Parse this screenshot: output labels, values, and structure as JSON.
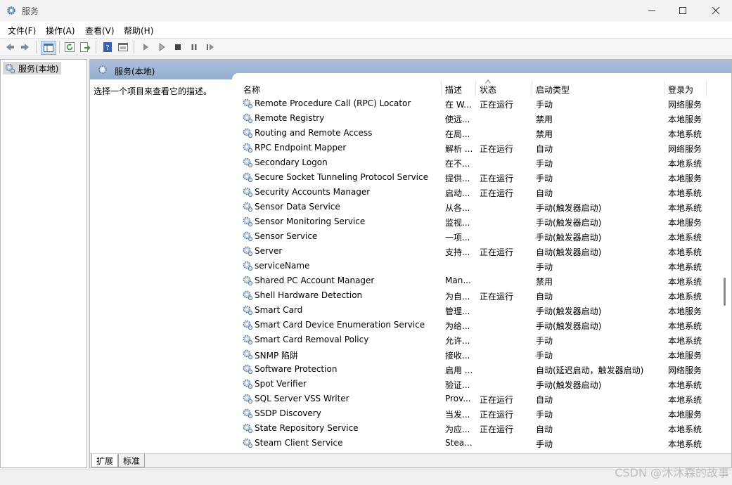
{
  "window": {
    "title": "服务"
  },
  "menu": [
    "文件(F)",
    "操作(A)",
    "查看(V)",
    "帮助(H)"
  ],
  "tree": {
    "root": "服务(本地)"
  },
  "content": {
    "header": "服务(本地)",
    "description": "选择一个项目来查看它的描述。"
  },
  "columns": {
    "name": "名称",
    "desc": "描述",
    "status": "状态",
    "startup": "启动类型",
    "logon": "登录为"
  },
  "services": [
    {
      "name": "Remote Procedure Call (RPC) Locator",
      "desc": "在 W...",
      "status": "正在运行",
      "startup": "手动",
      "logon": "网络服务"
    },
    {
      "name": "Remote Registry",
      "desc": "使远...",
      "status": "",
      "startup": "禁用",
      "logon": "本地服务"
    },
    {
      "name": "Routing and Remote Access",
      "desc": "在局...",
      "status": "",
      "startup": "禁用",
      "logon": "本地系统"
    },
    {
      "name": "RPC Endpoint Mapper",
      "desc": "解析 ...",
      "status": "正在运行",
      "startup": "自动",
      "logon": "网络服务"
    },
    {
      "name": "Secondary Logon",
      "desc": "在不...",
      "status": "",
      "startup": "手动",
      "logon": "本地系统"
    },
    {
      "name": "Secure Socket Tunneling Protocol Service",
      "desc": "提供...",
      "status": "正在运行",
      "startup": "手动",
      "logon": "本地服务"
    },
    {
      "name": "Security Accounts Manager",
      "desc": "启动...",
      "status": "正在运行",
      "startup": "自动",
      "logon": "本地系统"
    },
    {
      "name": "Sensor Data Service",
      "desc": "从各...",
      "status": "",
      "startup": "手动(触发器启动)",
      "logon": "本地系统"
    },
    {
      "name": "Sensor Monitoring Service",
      "desc": "监视...",
      "status": "",
      "startup": "手动(触发器启动)",
      "logon": "本地服务"
    },
    {
      "name": "Sensor Service",
      "desc": "一项...",
      "status": "",
      "startup": "手动(触发器启动)",
      "logon": "本地系统"
    },
    {
      "name": "Server",
      "desc": "支持...",
      "status": "正在运行",
      "startup": "自动(触发器启动)",
      "logon": "本地系统"
    },
    {
      "name": "serviceName",
      "desc": "",
      "status": "",
      "startup": "手动",
      "logon": "本地系统"
    },
    {
      "name": "Shared PC Account Manager",
      "desc": "Man...",
      "status": "",
      "startup": "禁用",
      "logon": "本地系统"
    },
    {
      "name": "Shell Hardware Detection",
      "desc": "为自...",
      "status": "正在运行",
      "startup": "自动",
      "logon": "本地系统"
    },
    {
      "name": "Smart Card",
      "desc": "管理...",
      "status": "",
      "startup": "手动(触发器启动)",
      "logon": "本地服务"
    },
    {
      "name": "Smart Card Device Enumeration Service",
      "desc": "为给...",
      "status": "",
      "startup": "手动(触发器启动)",
      "logon": "本地系统"
    },
    {
      "name": "Smart Card Removal Policy",
      "desc": "允许...",
      "status": "",
      "startup": "手动",
      "logon": "本地系统"
    },
    {
      "name": "SNMP 陷阱",
      "desc": "接收...",
      "status": "",
      "startup": "手动",
      "logon": "本地服务"
    },
    {
      "name": "Software Protection",
      "desc": "启用 ...",
      "status": "",
      "startup": "自动(延迟启动，触发器启动)",
      "logon": "网络服务"
    },
    {
      "name": "Spot Verifier",
      "desc": "验证...",
      "status": "",
      "startup": "手动(触发器启动)",
      "logon": "本地系统"
    },
    {
      "name": "SQL Server VSS Writer",
      "desc": "Prov...",
      "status": "正在运行",
      "startup": "自动",
      "logon": "本地系统"
    },
    {
      "name": "SSDP Discovery",
      "desc": "当发...",
      "status": "正在运行",
      "startup": "手动",
      "logon": "本地服务"
    },
    {
      "name": "State Repository Service",
      "desc": "为应...",
      "status": "正在运行",
      "startup": "自动",
      "logon": "本地系统"
    },
    {
      "name": "Steam Client Service",
      "desc": "Stea...",
      "status": "",
      "startup": "手动",
      "logon": "本地系统"
    }
  ],
  "tabs": [
    "扩展",
    "标准"
  ],
  "watermark": "CSDN @沐沐森的故事"
}
